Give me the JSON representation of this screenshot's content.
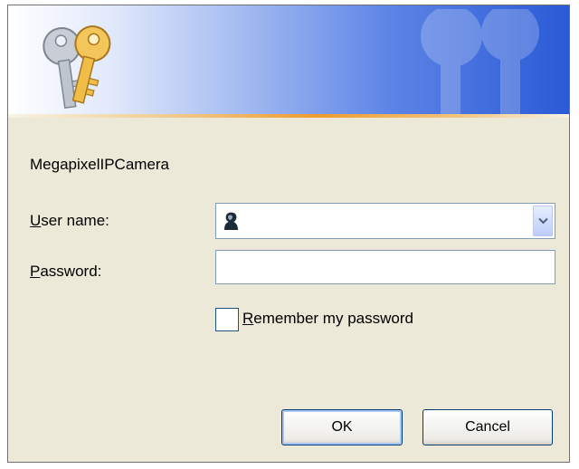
{
  "dialog": {
    "realm": "MegapixelIPCamera",
    "username_label_accel": "U",
    "username_label_rest": "ser name:",
    "username_value": "",
    "password_label_accel": "P",
    "password_label_rest": "assword:",
    "password_value": "",
    "remember_accel": "R",
    "remember_rest": "emember my password",
    "remember_checked": false,
    "ok_label": "OK",
    "cancel_label": "Cancel"
  },
  "icons": {
    "banner": "keys-icon",
    "watermark": "keys-watermark-icon",
    "user": "user-icon",
    "dropdown": "chevron-down-icon"
  }
}
